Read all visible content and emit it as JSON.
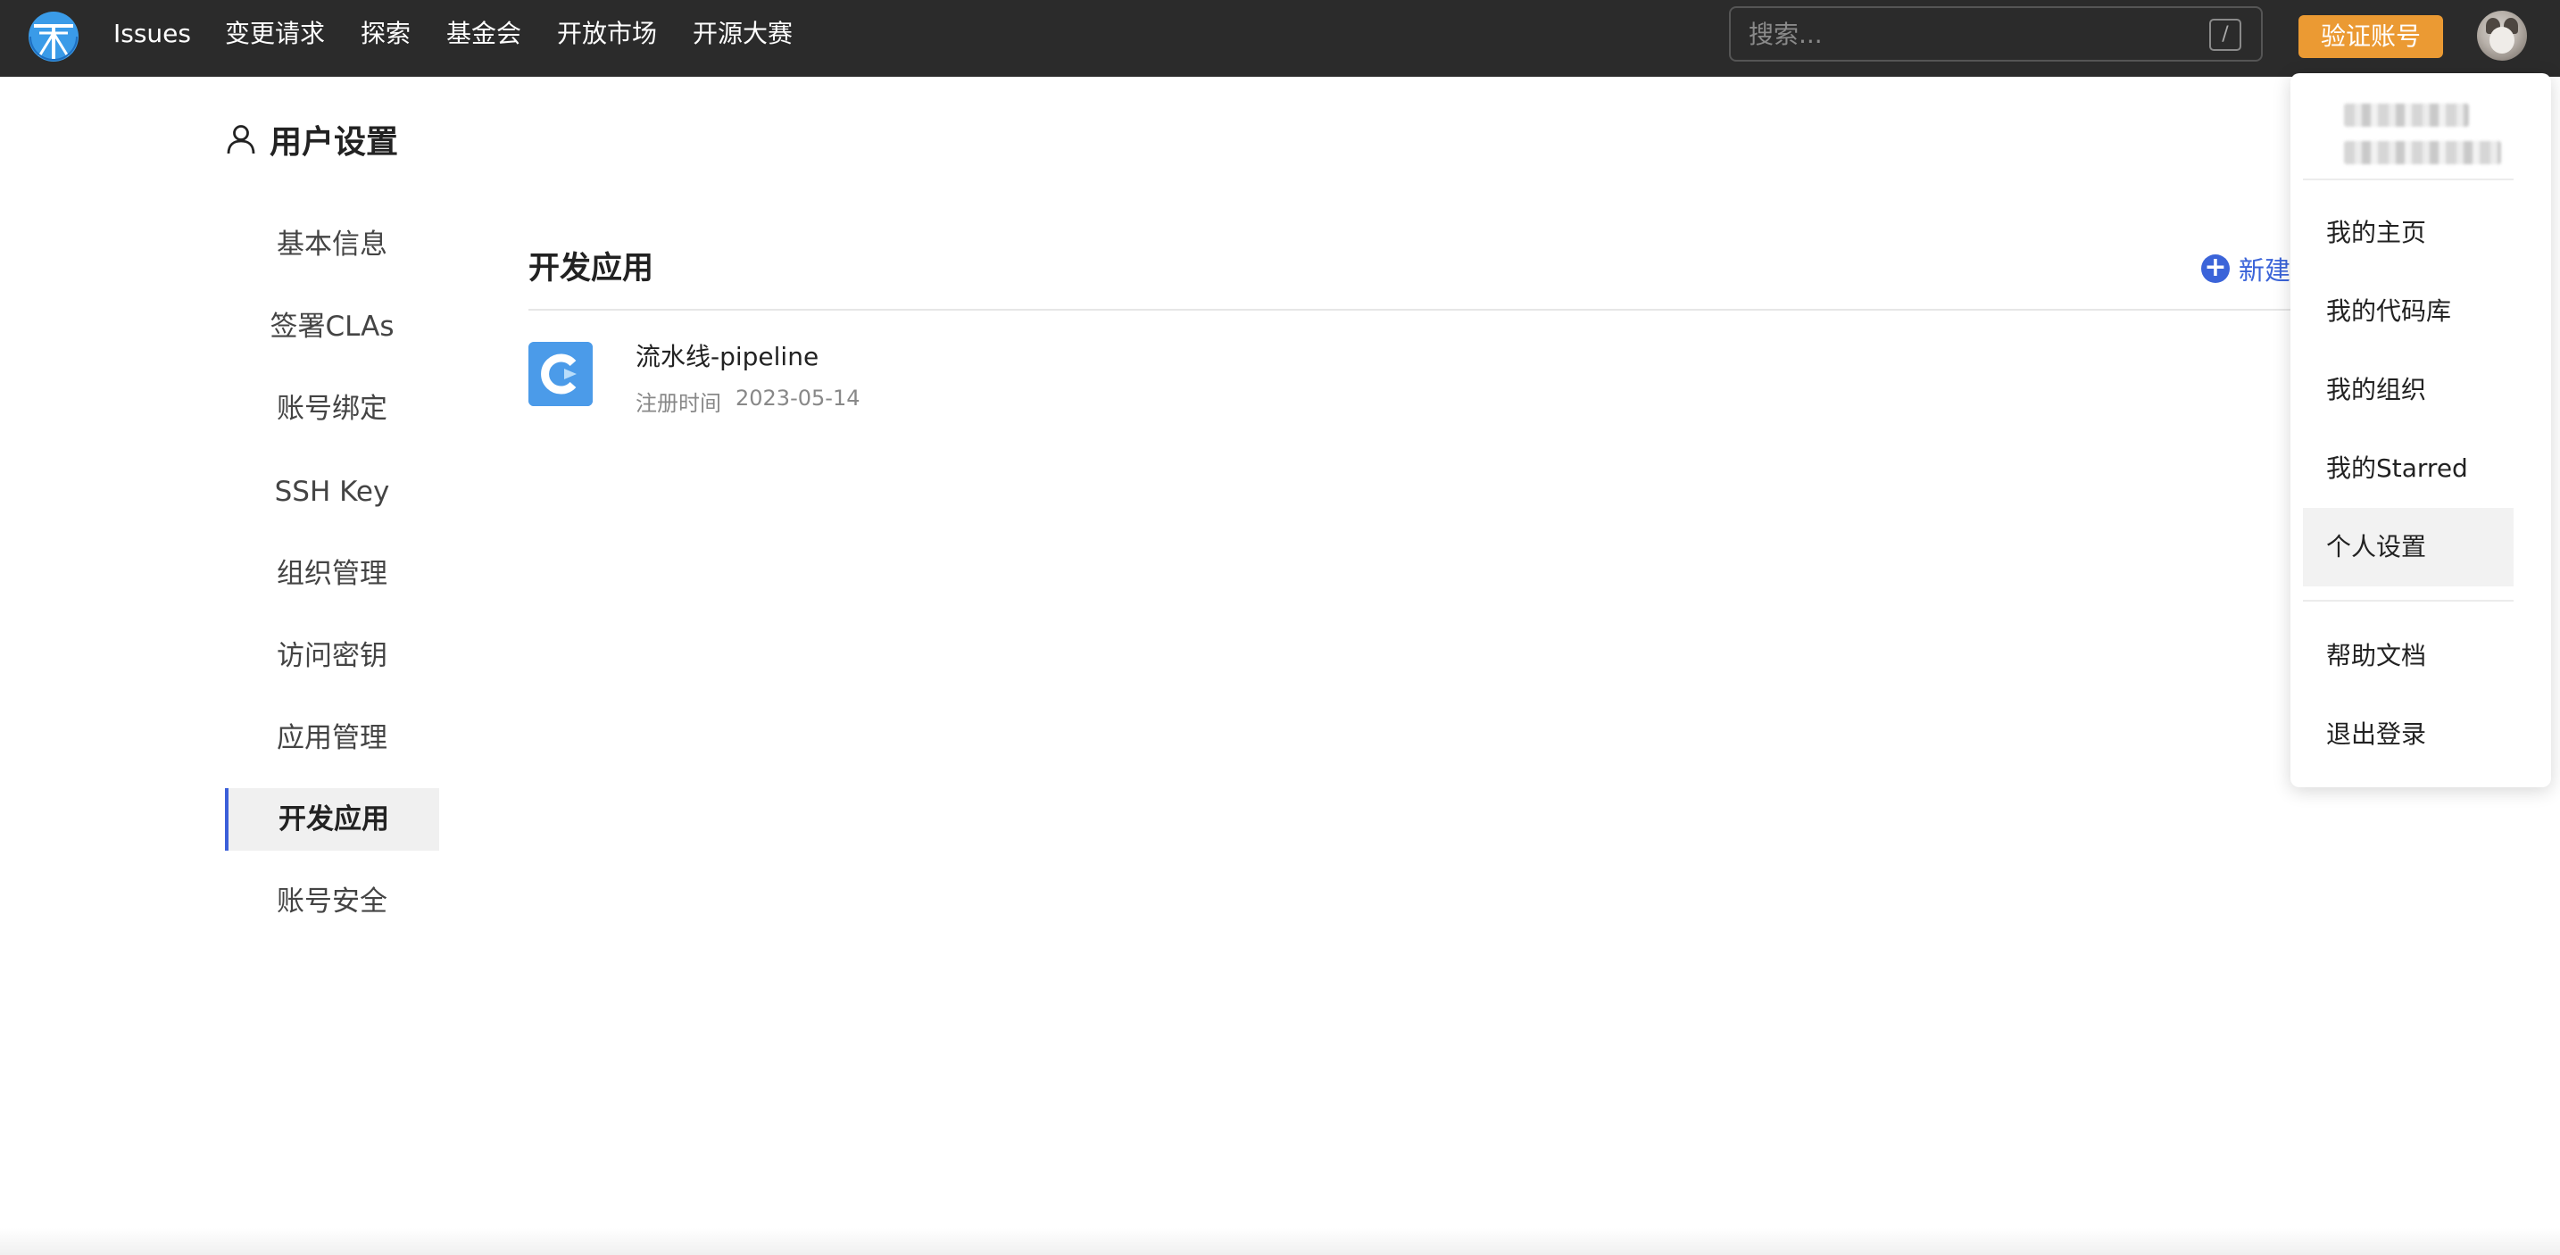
{
  "nav": {
    "items": [
      "Issues",
      "变更请求",
      "探索",
      "基金会",
      "开放市场",
      "开源大赛"
    ],
    "search_placeholder": "搜索...",
    "search_shortcut": "/",
    "verify_label": "验证账号"
  },
  "sidebar": {
    "title": "用户设置",
    "items": [
      "基本信息",
      "签署CLAs",
      "账号绑定",
      "SSH Key",
      "组织管理",
      "访问密钥",
      "应用管理",
      "开发应用",
      "账号安全"
    ],
    "active_index": 7
  },
  "main": {
    "title": "开发应用",
    "new_label": "新建",
    "apps": [
      {
        "name": "流水线-pipeline",
        "reg_label": "注册时间",
        "reg_date": "2023-05-14"
      }
    ]
  },
  "dropdown": {
    "items": [
      "我的主页",
      "我的代码库",
      "我的组织",
      "我的Starred",
      "个人设置"
    ],
    "hover_index": 4,
    "footer_items": [
      "帮助文档",
      "退出登录"
    ]
  },
  "colors": {
    "topbar": "#2b2b2b",
    "accent_orange": "#eb9a33",
    "accent_blue": "#3b64d9"
  }
}
